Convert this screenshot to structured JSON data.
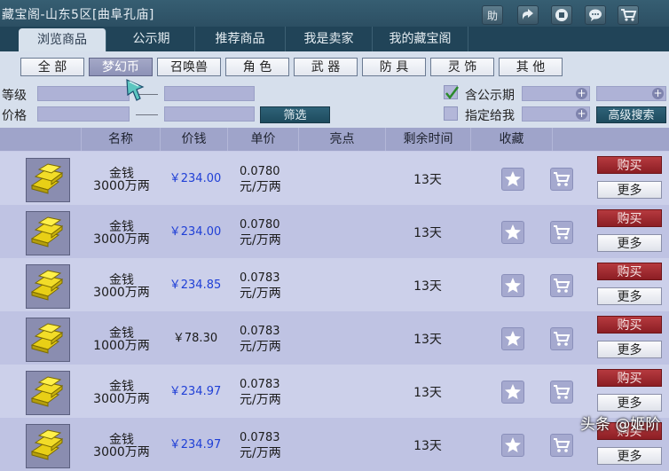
{
  "window": {
    "title": "藏宝阁-山东5区[曲阜孔庙]"
  },
  "toolbar": {
    "help_label": "助"
  },
  "tabs": [
    {
      "label": "浏览商品",
      "active": true
    },
    {
      "label": "公示期"
    },
    {
      "label": "推荐商品"
    },
    {
      "label": "我是卖家"
    },
    {
      "label": "我的藏宝阁"
    }
  ],
  "categories": [
    {
      "label": "全 部"
    },
    {
      "label": "梦幻币",
      "selected": true
    },
    {
      "label": "召唤兽"
    },
    {
      "label": "角 色"
    },
    {
      "label": "武 器"
    },
    {
      "label": "防 具"
    },
    {
      "label": "灵 饰"
    },
    {
      "label": "其 他"
    }
  ],
  "filters": {
    "level_label": "等级",
    "price_label": "价格",
    "filter_button": "筛选",
    "public_period_label": "含公示期",
    "public_period_checked": true,
    "assigned_label": "指定给我",
    "assigned_checked": false,
    "advanced_button": "高级搜索"
  },
  "columns": [
    "名称",
    "价钱",
    "单价",
    "亮点",
    "剩余时间",
    "收藏"
  ],
  "rows": [
    {
      "name": "金钱",
      "amount": "3000万两",
      "price": "￥234.00",
      "unit_value": "0.0780",
      "unit_suffix": "元/万两",
      "time": "13天",
      "buy": "购买",
      "more": "更多"
    },
    {
      "name": "金钱",
      "amount": "3000万两",
      "price": "￥234.00",
      "unit_value": "0.0780",
      "unit_suffix": "元/万两",
      "time": "13天",
      "buy": "购买",
      "more": "更多"
    },
    {
      "name": "金钱",
      "amount": "3000万两",
      "price": "￥234.85",
      "unit_value": "0.0783",
      "unit_suffix": "元/万两",
      "time": "13天",
      "buy": "购买",
      "more": "更多"
    },
    {
      "name": "金钱",
      "amount": "1000万两",
      "price": "￥78.30",
      "unit_value": "0.0783",
      "unit_suffix": "元/万两",
      "time": "13天",
      "buy": "购买",
      "more": "更多"
    },
    {
      "name": "金钱",
      "amount": "3000万两",
      "price": "￥234.97",
      "unit_value": "0.0783",
      "unit_suffix": "元/万两",
      "time": "13天",
      "buy": "购买",
      "more": "更多"
    },
    {
      "name": "金钱",
      "amount": "3000万两",
      "price": "￥234.97",
      "unit_value": "0.0783",
      "unit_suffix": "元/万两",
      "time": "13天",
      "buy": "购买",
      "more": "更多"
    }
  ],
  "price_colors": [
    "#1f3fd6",
    "#1f3fd6",
    "#1f3fd6",
    "#1b1b1b",
    "#1f3fd6",
    "#1f3fd6"
  ],
  "watermark": "头条 @姬阶"
}
